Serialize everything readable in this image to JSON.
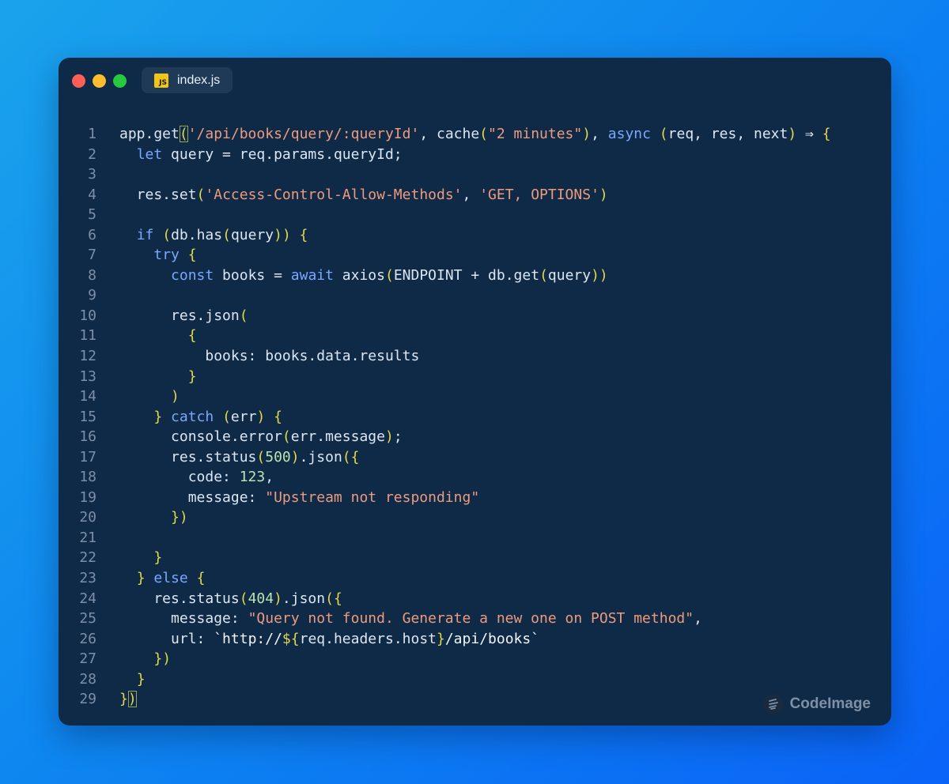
{
  "window": {
    "tab": {
      "icon_text": "JS",
      "label": "index.js"
    },
    "traffic_lights": {
      "close_color": "#ff5f57",
      "minimize_color": "#febc2e",
      "maximize_color": "#28c840"
    }
  },
  "editor": {
    "lines": [
      {
        "n": "1",
        "tokens": [
          [
            "plain",
            "app.get"
          ],
          [
            "hl",
            "("
          ],
          [
            "str",
            "'/api/books/query/:queryId'"
          ],
          [
            "plain",
            ", cache"
          ],
          [
            "brace",
            "("
          ],
          [
            "str",
            "\"2 minutes\""
          ],
          [
            "brace",
            ")"
          ],
          [
            "plain",
            ", "
          ],
          [
            "kw",
            "async"
          ],
          [
            "plain",
            " "
          ],
          [
            "brace",
            "("
          ],
          [
            "plain",
            "req, res, next"
          ],
          [
            "brace",
            ")"
          ],
          [
            "plain",
            " "
          ],
          [
            "op",
            "⇒"
          ],
          [
            "plain",
            " "
          ],
          [
            "brace",
            "{"
          ]
        ]
      },
      {
        "n": "2",
        "tokens": [
          [
            "plain",
            "  "
          ],
          [
            "kw",
            "let"
          ],
          [
            "plain",
            " query = req.params.queryId;"
          ]
        ]
      },
      {
        "n": "3",
        "tokens": []
      },
      {
        "n": "4",
        "tokens": [
          [
            "plain",
            "  res.set"
          ],
          [
            "brace",
            "("
          ],
          [
            "str",
            "'Access-Control-Allow-Methods'"
          ],
          [
            "plain",
            ", "
          ],
          [
            "str",
            "'GET, OPTIONS'"
          ],
          [
            "brace",
            ")"
          ]
        ]
      },
      {
        "n": "5",
        "tokens": []
      },
      {
        "n": "6",
        "tokens": [
          [
            "plain",
            "  "
          ],
          [
            "kw",
            "if"
          ],
          [
            "plain",
            " "
          ],
          [
            "brace",
            "("
          ],
          [
            "plain",
            "db.has"
          ],
          [
            "brace",
            "("
          ],
          [
            "plain",
            "query"
          ],
          [
            "brace",
            "))"
          ],
          [
            "plain",
            " "
          ],
          [
            "brace",
            "{"
          ]
        ]
      },
      {
        "n": "7",
        "tokens": [
          [
            "plain",
            "    "
          ],
          [
            "kw",
            "try"
          ],
          [
            "plain",
            " "
          ],
          [
            "brace",
            "{"
          ]
        ]
      },
      {
        "n": "8",
        "tokens": [
          [
            "plain",
            "      "
          ],
          [
            "kw",
            "const"
          ],
          [
            "plain",
            " books = "
          ],
          [
            "kw",
            "await"
          ],
          [
            "plain",
            " axios"
          ],
          [
            "brace",
            "("
          ],
          [
            "plain",
            "ENDPOINT + db.get"
          ],
          [
            "brace",
            "("
          ],
          [
            "plain",
            "query"
          ],
          [
            "brace",
            "))"
          ]
        ]
      },
      {
        "n": "9",
        "tokens": []
      },
      {
        "n": "10",
        "tokens": [
          [
            "plain",
            "      res.json"
          ],
          [
            "brace",
            "("
          ]
        ]
      },
      {
        "n": "11",
        "tokens": [
          [
            "plain",
            "        "
          ],
          [
            "brace",
            "{"
          ]
        ]
      },
      {
        "n": "12",
        "tokens": [
          [
            "plain",
            "          books: books.data.results"
          ]
        ]
      },
      {
        "n": "13",
        "tokens": [
          [
            "plain",
            "        "
          ],
          [
            "brace",
            "}"
          ]
        ]
      },
      {
        "n": "14",
        "tokens": [
          [
            "plain",
            "      "
          ],
          [
            "brace",
            ")"
          ]
        ]
      },
      {
        "n": "15",
        "tokens": [
          [
            "plain",
            "    "
          ],
          [
            "brace",
            "}"
          ],
          [
            "plain",
            " "
          ],
          [
            "kw",
            "catch"
          ],
          [
            "plain",
            " "
          ],
          [
            "brace",
            "("
          ],
          [
            "plain",
            "err"
          ],
          [
            "brace",
            ")"
          ],
          [
            "plain",
            " "
          ],
          [
            "brace",
            "{"
          ]
        ]
      },
      {
        "n": "16",
        "tokens": [
          [
            "plain",
            "      console.error"
          ],
          [
            "brace",
            "("
          ],
          [
            "plain",
            "err.message"
          ],
          [
            "brace",
            ")"
          ],
          [
            "plain",
            ";"
          ]
        ]
      },
      {
        "n": "17",
        "tokens": [
          [
            "plain",
            "      res.status"
          ],
          [
            "brace",
            "("
          ],
          [
            "num",
            "500"
          ],
          [
            "brace",
            ")"
          ],
          [
            "plain",
            ".json"
          ],
          [
            "brace",
            "({"
          ]
        ]
      },
      {
        "n": "18",
        "tokens": [
          [
            "plain",
            "        code: "
          ],
          [
            "num",
            "123"
          ],
          [
            "plain",
            ","
          ]
        ]
      },
      {
        "n": "19",
        "tokens": [
          [
            "plain",
            "        message: "
          ],
          [
            "str",
            "\"Upstream not responding\""
          ]
        ]
      },
      {
        "n": "20",
        "tokens": [
          [
            "plain",
            "      "
          ],
          [
            "brace",
            "})"
          ]
        ]
      },
      {
        "n": "21",
        "tokens": []
      },
      {
        "n": "22",
        "tokens": [
          [
            "plain",
            "    "
          ],
          [
            "brace",
            "}"
          ]
        ]
      },
      {
        "n": "23",
        "tokens": [
          [
            "plain",
            "  "
          ],
          [
            "brace",
            "}"
          ],
          [
            "plain",
            " "
          ],
          [
            "kw",
            "else"
          ],
          [
            "plain",
            " "
          ],
          [
            "brace",
            "{"
          ]
        ]
      },
      {
        "n": "24",
        "tokens": [
          [
            "plain",
            "    res.status"
          ],
          [
            "brace",
            "("
          ],
          [
            "num",
            "404"
          ],
          [
            "brace",
            ")"
          ],
          [
            "plain",
            ".json"
          ],
          [
            "brace",
            "({"
          ]
        ]
      },
      {
        "n": "25",
        "tokens": [
          [
            "plain",
            "      message: "
          ],
          [
            "str",
            "\"Query not found. Generate a new one on POST method\""
          ],
          [
            "plain",
            ","
          ]
        ]
      },
      {
        "n": "26",
        "tokens": [
          [
            "plain",
            "      url: "
          ],
          [
            "tpl",
            "`http://"
          ],
          [
            "brace",
            "${"
          ],
          [
            "plain",
            "req.headers.host"
          ],
          [
            "brace",
            "}"
          ],
          [
            "tpl",
            "/api/books`"
          ]
        ]
      },
      {
        "n": "27",
        "tokens": [
          [
            "plain",
            "    "
          ],
          [
            "brace",
            "})"
          ]
        ]
      },
      {
        "n": "28",
        "tokens": [
          [
            "plain",
            "  "
          ],
          [
            "brace",
            "}"
          ]
        ]
      },
      {
        "n": "29",
        "tokens": [
          [
            "brace",
            "}"
          ],
          [
            "hl",
            ")"
          ]
        ]
      }
    ]
  },
  "watermark": {
    "label": "CodeImage"
  }
}
